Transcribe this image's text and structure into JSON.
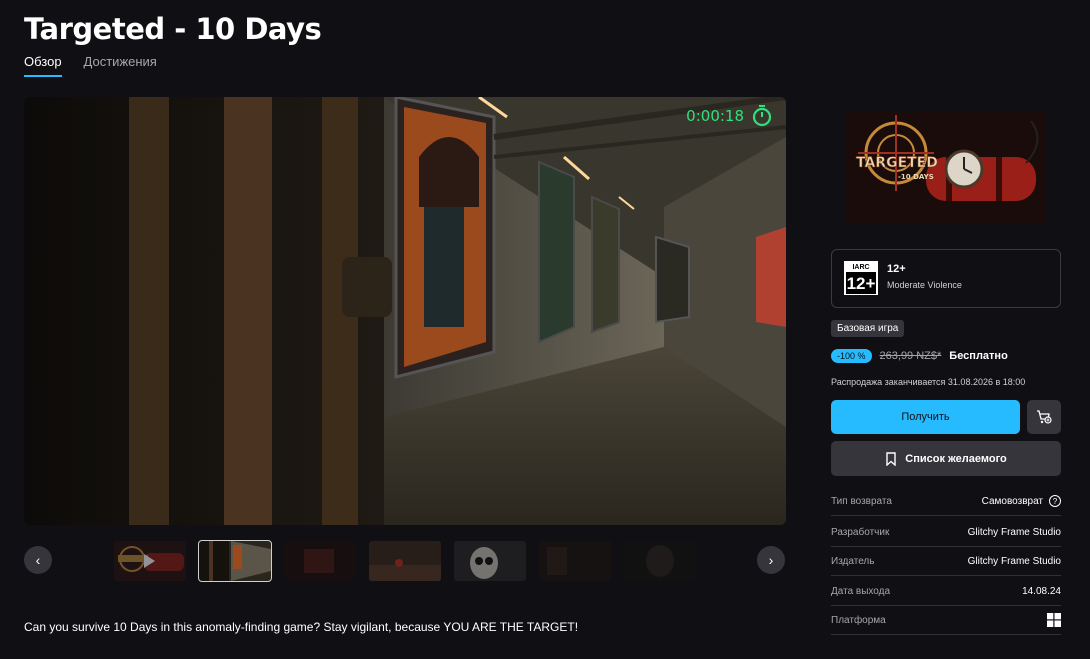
{
  "game": {
    "title": "Targeted - 10 Days"
  },
  "tabs": [
    {
      "label": "Обзор",
      "active": true
    },
    {
      "label": "Достижения",
      "active": false
    }
  ],
  "media": {
    "timer": "0:00:18"
  },
  "thumbnails": [
    {
      "kind": "video"
    },
    {
      "kind": "image",
      "active": true
    },
    {
      "kind": "image"
    },
    {
      "kind": "image"
    },
    {
      "kind": "image"
    },
    {
      "kind": "image"
    },
    {
      "kind": "image"
    }
  ],
  "description": "Can you survive 10 Days in this anomaly-finding game? Stay vigilant, because YOU ARE THE TARGET!",
  "sidebar": {
    "rating": {
      "board_label": "IARC",
      "board_age": "12+",
      "age": "12+",
      "descriptor": "Moderate Violence"
    },
    "base_game_badge": "Базовая игра",
    "price": {
      "discount": "-100 %",
      "original": "263,99 NZ$*",
      "current": "Бесплатно"
    },
    "sale_end": "Распродажа заканчивается 31.08.2026 в 18:00",
    "get_button": "Получить",
    "wishlist_button": "Список желаемого",
    "info": [
      {
        "key": "Тип возврата",
        "value": "Самовозврат"
      },
      {
        "key": "Разработчик",
        "value": "Glitchy Frame Studio"
      },
      {
        "key": "Издатель",
        "value": "Glitchy Frame Studio"
      },
      {
        "key": "Дата выхода",
        "value": "14.08.24"
      },
      {
        "key": "Платформа",
        "value": ""
      }
    ]
  },
  "colors": {
    "background": "#101014",
    "accent": "#26bbff",
    "timer": "#2fe07c",
    "button_secondary": "#35353b"
  }
}
